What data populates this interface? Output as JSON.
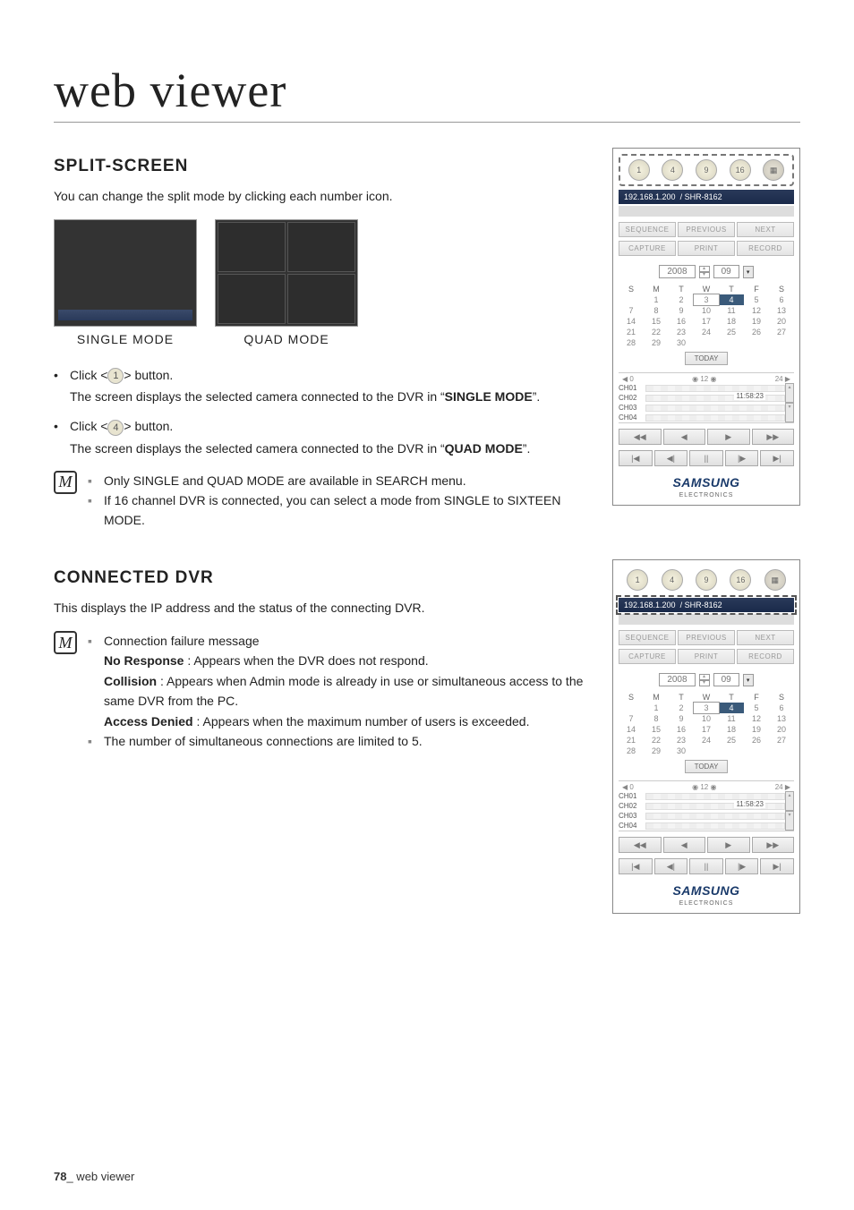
{
  "page": {
    "title": "web viewer",
    "footer_page": "78",
    "footer_label": "_ web viewer"
  },
  "section1": {
    "heading": "SPLIT-SCREEN",
    "intro": "You can change the split mode by clicking each number icon.",
    "single_label": "SINGLE MODE",
    "quad_label": "QUAD MODE",
    "bullet1_pre": "Click <",
    "bullet1_btn": "1",
    "bullet1_post": "> button.",
    "bullet1_line2a": "The screen displays the selected camera connected to the DVR in “",
    "bullet1_strong": "SINGLE MODE",
    "bullet1_line2b": "”.",
    "bullet2_pre": "Click <",
    "bullet2_btn": "4",
    "bullet2_post": "> button.",
    "bullet2_line2a": "The screen displays the selected camera connected to the DVR in “",
    "bullet2_strong": "QUAD MODE",
    "bullet2_line2b": "”.",
    "note1": "Only SINGLE and QUAD MODE are available in SEARCH menu.",
    "note2": "If 16 channel DVR is connected, you can select a mode from SINGLE to SIXTEEN MODE."
  },
  "section2": {
    "heading": "CONNECTED DVR",
    "intro": "This displays the IP address and the status of the connecting DVR.",
    "note_head": "Connection failure message",
    "msg1_label": "No Response",
    "msg1_text": " : Appears when the DVR does not respond.",
    "msg2_label": "Collision",
    "msg2_text": " : Appears when Admin mode is already in use or simultaneous access to the same DVR from the PC.",
    "msg3_label": "Access Denied",
    "msg3_text": " : Appears when the maximum number of users is exceeded.",
    "note_last": "The number of simultaneous connections are limited to 5."
  },
  "panel": {
    "modes": [
      "1",
      "4",
      "9",
      "16"
    ],
    "ip": "192.168.1.200",
    "model": "/ SHR-8162",
    "row1": [
      "SEQUENCE",
      "PREVIOUS",
      "NEXT"
    ],
    "row2": [
      "CAPTURE",
      "PRINT",
      "RECORD"
    ],
    "year": "2008",
    "month": "09",
    "dow": [
      "S",
      "M",
      "T",
      "W",
      "T",
      "F",
      "S"
    ],
    "weeks": [
      [
        "",
        "1",
        "2",
        "3",
        "4",
        "5",
        "6"
      ],
      [
        "7",
        "8",
        "9",
        "10",
        "11",
        "12",
        "13"
      ],
      [
        "14",
        "15",
        "16",
        "17",
        "18",
        "19",
        "20"
      ],
      [
        "21",
        "22",
        "23",
        "24",
        "25",
        "26",
        "27"
      ],
      [
        "28",
        "29",
        "30",
        "",
        "",
        "",
        ""
      ]
    ],
    "today": "TODAY",
    "tl_left": "0",
    "tl_mid": "12",
    "tl_right": "24",
    "tl_time": "11:58:23",
    "channels": [
      "CH01",
      "CH02",
      "CH03",
      "CH04"
    ],
    "play1": [
      "◀◀",
      "◀",
      "▶",
      "▶▶"
    ],
    "play2": [
      "|◀",
      "◀|",
      "||",
      "|▶",
      "▶|"
    ],
    "logo": "SAMSUNG",
    "logo_sub": "ELECTRONICS"
  }
}
